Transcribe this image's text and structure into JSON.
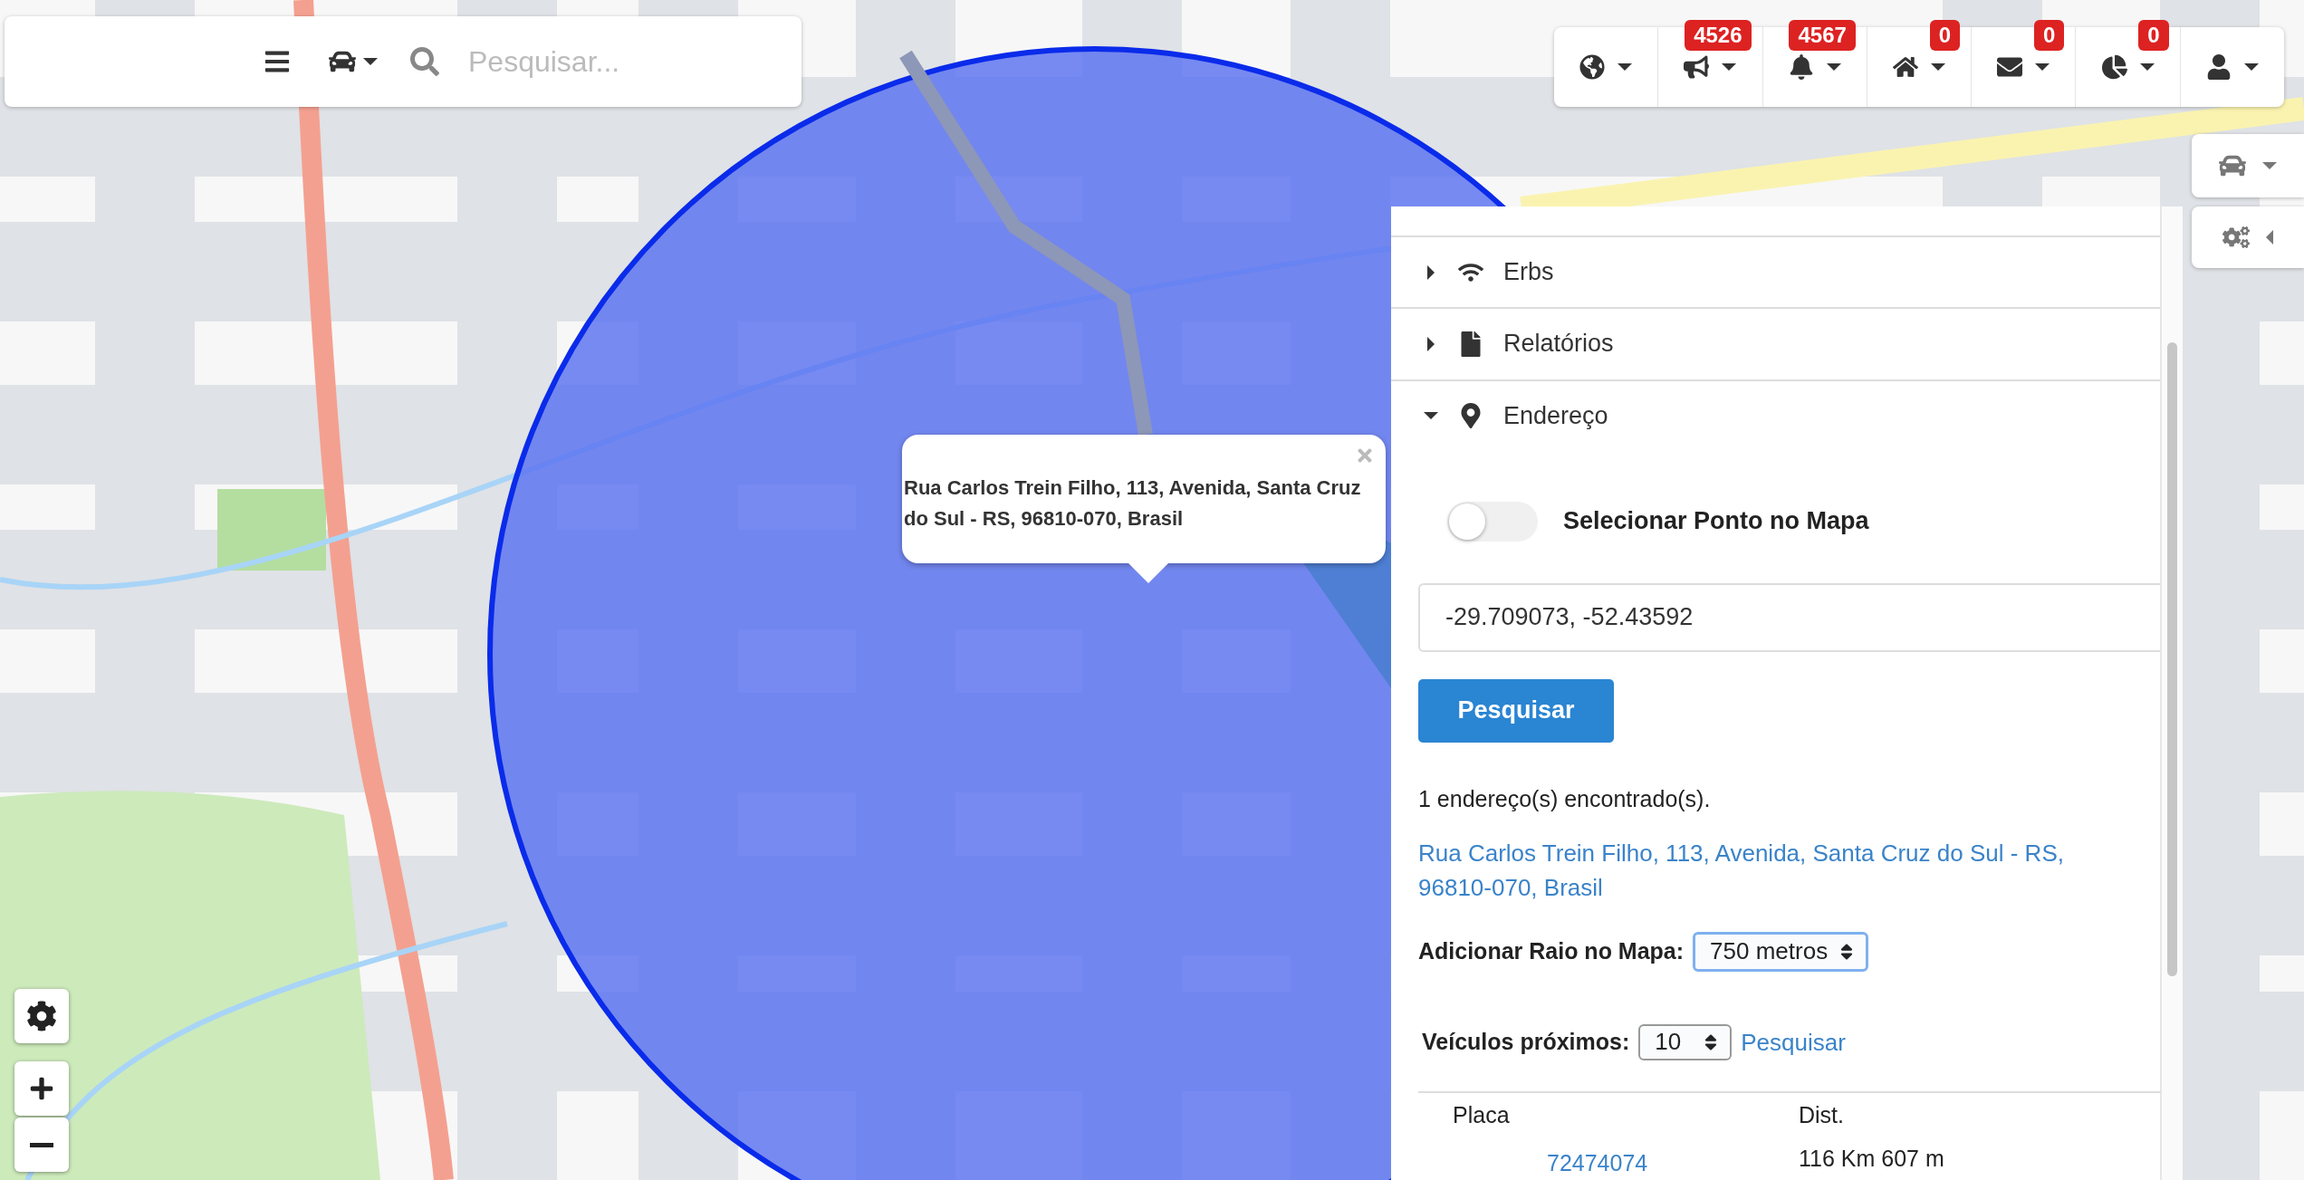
{
  "search_bar": {
    "placeholder": "Pesquisar..."
  },
  "toolbar": {
    "badges": [
      "4526",
      "4567",
      "0",
      "0",
      "0"
    ]
  },
  "settings_panel": {
    "expanded": false
  },
  "popup": {
    "text": "Rua Carlos Trein Filho, 113, Avenida, Santa Cruz do Sul - RS, 96810-070, Brasil"
  },
  "panel": {
    "sections": [
      {
        "title": "Erbs",
        "expanded": false
      },
      {
        "title": "Relatórios",
        "expanded": false
      },
      {
        "title": "Endereço",
        "expanded": true
      }
    ],
    "address": {
      "pick_on_map": {
        "label": "Selecionar Ponto no Mapa",
        "on": false
      },
      "query": "-29.709073, -52.43592",
      "search_button": "Pesquisar",
      "result_count": "1 endereço(s) encontrado(s).",
      "results": [
        "Rua Carlos Trein Filho, 113, Avenida, Santa Cruz do Sul - RS, 96810-070, Brasil"
      ],
      "radius": {
        "label": "Adicionar Raio no Mapa:",
        "value": "750 metros"
      },
      "nearby": {
        "label": "Veículos próximos:",
        "value": "10",
        "link": "Pesquisar"
      },
      "table": {
        "columns": [
          "Placa",
          "Dist."
        ],
        "rows": [
          [
            "72474074",
            "116 Km 607 m"
          ]
        ]
      }
    }
  }
}
